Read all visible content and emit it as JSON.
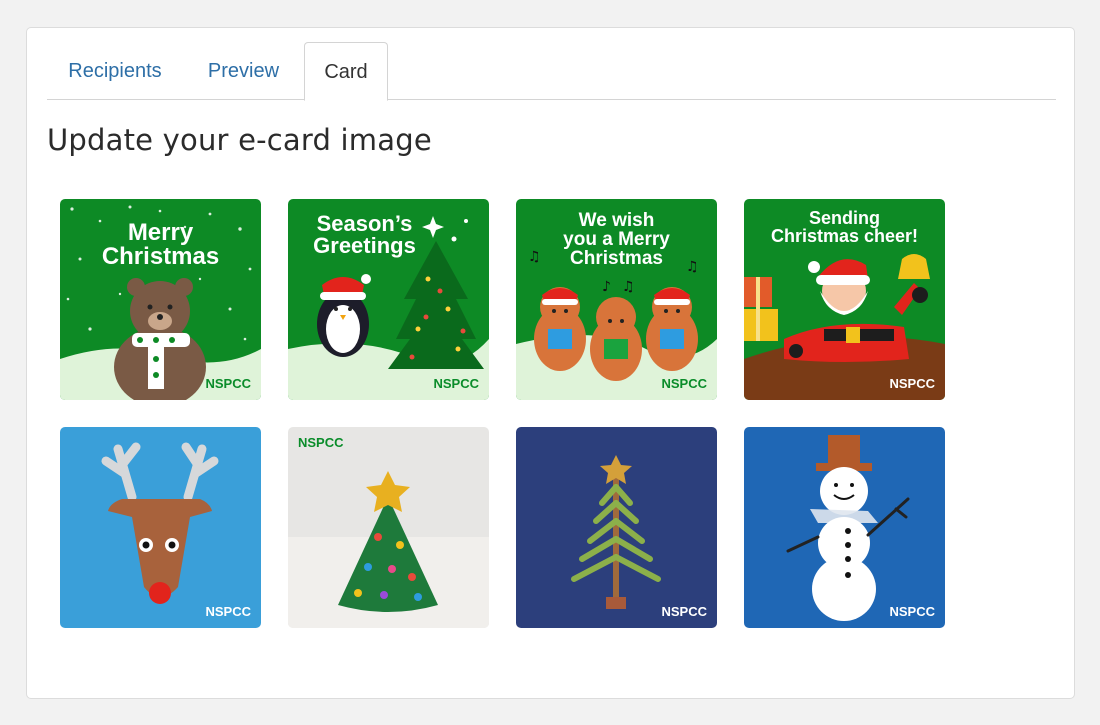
{
  "tabs": {
    "recipients": "Recipients",
    "preview": "Preview",
    "card": "Card",
    "active": "card"
  },
  "page_title": "Update your e-card image",
  "brand": "NSPCC",
  "cards": [
    {
      "id": "merry-christmas",
      "lines": [
        "Merry",
        "Christmas"
      ],
      "subject": "bear-icon",
      "background": "#0d8a25"
    },
    {
      "id": "seasons-greetings",
      "lines": [
        "Season’s",
        "Greetings"
      ],
      "subject": "penguin-tree-icon",
      "background": "#0d8a25"
    },
    {
      "id": "we-wish-you",
      "lines": [
        "We wish",
        "you a Merry",
        "Christmas"
      ],
      "subject": "squirrels-icon",
      "background": "#0d8a25"
    },
    {
      "id": "sending-cheer",
      "lines": [
        "Sending",
        "Christmas cheer!"
      ],
      "subject": "santa-icon",
      "background": "#0d8a25"
    },
    {
      "id": "reindeer",
      "lines": [],
      "subject": "reindeer-icon",
      "background": "#3a9fd9"
    },
    {
      "id": "cone-tree",
      "lines": [],
      "subject": "cone-tree-icon",
      "background": "#e7e6e4"
    },
    {
      "id": "stick-tree",
      "lines": [],
      "subject": "stick-tree-icon",
      "background": "#2c3f7c"
    },
    {
      "id": "snowman",
      "lines": [],
      "subject": "snowman-icon",
      "background": "#1f67b5"
    }
  ]
}
